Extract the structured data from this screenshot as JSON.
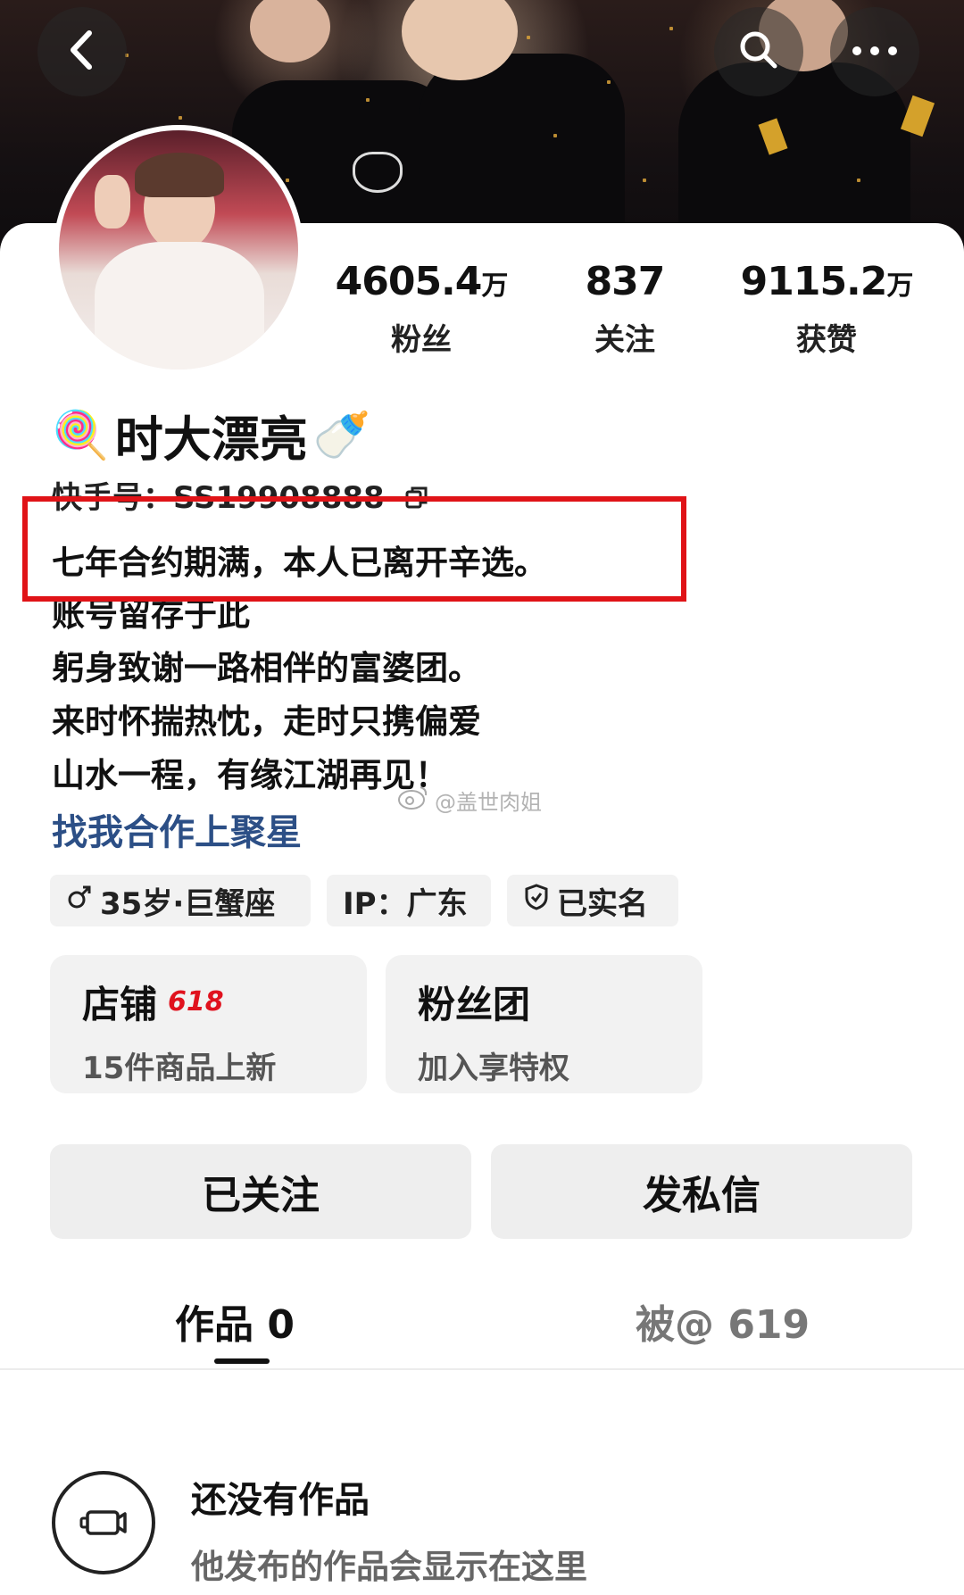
{
  "header": {
    "back_icon": "chevron-left-icon",
    "search_icon": "search-icon",
    "more_icon": "more-horizontal-icon"
  },
  "stats": [
    {
      "value": "4605.4",
      "unit": "万",
      "label": "粉丝"
    },
    {
      "value": "837",
      "unit": "",
      "label": "关注"
    },
    {
      "value": "9115.2",
      "unit": "万",
      "label": "获赞"
    }
  ],
  "profile": {
    "name": "时大漂亮",
    "name_prefix_emoji": "🍭",
    "name_suffix_emoji": "🍼",
    "kuaishou_id": "快手号：SS19908888",
    "copy_icon": "copy-icon"
  },
  "bio": {
    "lines": [
      "七年合约期满，本人已离开辛选。",
      "账号留存于此",
      "躬身致谢一路相伴的富婆团。",
      "来时怀揣热忱，走时只携偏爱",
      "山水一程，有缘江湖再见！"
    ],
    "link": "找我合作上聚星"
  },
  "watermark": "@盖世肉姐",
  "tags": {
    "age": "35岁·巨蟹座",
    "gender_icon": "male-icon",
    "ip": "IP：广东",
    "verified": "已实名",
    "verified_icon": "shield-check-icon"
  },
  "cards": [
    {
      "title": "店铺",
      "badge": "618",
      "subtitle": "15件商品上新"
    },
    {
      "title": "粉丝团",
      "badge": "",
      "subtitle": "加入享特权"
    }
  ],
  "actions": {
    "follow": "已关注",
    "message": "发私信"
  },
  "tabs": [
    {
      "label": "作品 0",
      "active": true
    },
    {
      "label": "被@ 619",
      "active": false
    }
  ],
  "empty_state": {
    "title": "还没有作品",
    "subtitle": "他发布的作品会显示在这里",
    "icon": "video-camera-icon"
  },
  "colors": {
    "highlight_border": "#e01317",
    "link": "#2c4f86",
    "badge_red": "#e0121e"
  }
}
